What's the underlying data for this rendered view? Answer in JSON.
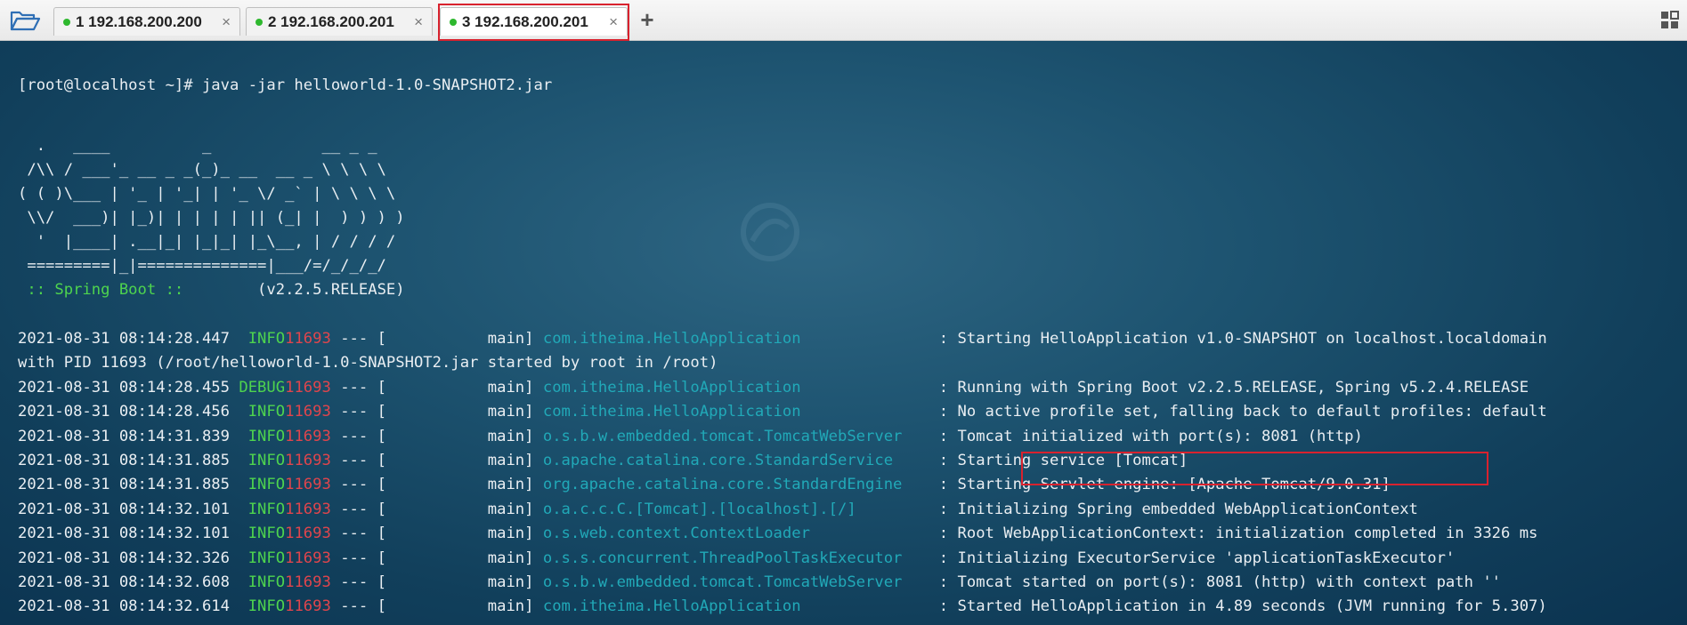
{
  "tabs": [
    {
      "label": "1 192.168.200.200",
      "active": false
    },
    {
      "label": "2 192.168.200.201",
      "active": false
    },
    {
      "label": "3 192.168.200.201",
      "active": true
    }
  ],
  "tab_close_glyph": "×",
  "add_tab_glyph": "+",
  "icons": {
    "open_folder": "folder-open-icon",
    "layout": "grid-layout-icon",
    "status_dot": "green-dot-icon"
  },
  "colors": {
    "highlight_box": "#d9222e",
    "spring_label": "#4ed44e",
    "logger": "#21a9b8",
    "pid": "#e0454c",
    "text": "#e9eef2"
  },
  "terminal": {
    "prompt_line": "[root@localhost ~]# java -jar helloworld-1.0-SNAPSHOT2.jar",
    "banner": [
      "  .   ____          _            __ _ _",
      " /\\\\ / ___'_ __ _ _(_)_ __  __ _ \\ \\ \\ \\",
      "( ( )\\___ | '_ | '_| | '_ \\/ _` | \\ \\ \\ \\",
      " \\\\/  ___)| |_)| | | | | || (_| |  ) ) ) )",
      "  '  |____| .__|_| |_|_| |_\\__, | / / / /",
      " =========|_|==============|___/=/_/_/_/"
    ],
    "spring_label": " :: Spring Boot :: ",
    "spring_version": "       (v2.2.5.RELEASE)",
    "logs": [
      {
        "ts": "2021-08-31 08:14:28.447",
        "level": "  INFO",
        "pid": "11693",
        "thread": " --- [           main] ",
        "logger": "com.itheima.HelloApplication              ",
        "msg": " : Starting HelloApplication v1.0-SNAPSHOT on localhost.localdomain"
      },
      {
        "ts": "",
        "level": "",
        "pid": "",
        "thread": "",
        "logger": "",
        "msg": "with PID 11693 (/root/helloworld-1.0-SNAPSHOT2.jar started by root in /root)"
      },
      {
        "ts": "2021-08-31 08:14:28.455",
        "level": " DEBUG",
        "pid": "11693",
        "thread": " --- [           main] ",
        "logger": "com.itheima.HelloApplication              ",
        "msg": " : Running with Spring Boot v2.2.5.RELEASE, Spring v5.2.4.RELEASE"
      },
      {
        "ts": "2021-08-31 08:14:28.456",
        "level": "  INFO",
        "pid": "11693",
        "thread": " --- [           main] ",
        "logger": "com.itheima.HelloApplication              ",
        "msg": " : No active profile set, falling back to default profiles: default"
      },
      {
        "ts": "2021-08-31 08:14:31.839",
        "level": "  INFO",
        "pid": "11693",
        "thread": " --- [           main] ",
        "logger": "o.s.b.w.embedded.tomcat.TomcatWebServer   ",
        "msg": " : Tomcat initialized with port(s): 8081 (http)"
      },
      {
        "ts": "2021-08-31 08:14:31.885",
        "level": "  INFO",
        "pid": "11693",
        "thread": " --- [           main] ",
        "logger": "o.apache.catalina.core.StandardService    ",
        "msg": " : Starting service [Tomcat]"
      },
      {
        "ts": "2021-08-31 08:14:31.885",
        "level": "  INFO",
        "pid": "11693",
        "thread": " --- [           main] ",
        "logger": "org.apache.catalina.core.StandardEngine   ",
        "msg": " : Starting Servlet engine: [Apache Tomcat/9.0.31]"
      },
      {
        "ts": "2021-08-31 08:14:32.101",
        "level": "  INFO",
        "pid": "11693",
        "thread": " --- [           main] ",
        "logger": "o.a.c.c.C.[Tomcat].[localhost].[/]        ",
        "msg": " : Initializing Spring embedded WebApplicationContext"
      },
      {
        "ts": "2021-08-31 08:14:32.101",
        "level": "  INFO",
        "pid": "11693",
        "thread": " --- [           main] ",
        "logger": "o.s.web.context.ContextLoader             ",
        "msg": " : Root WebApplicationContext: initialization completed in 3326 ms"
      },
      {
        "ts": "2021-08-31 08:14:32.326",
        "level": "  INFO",
        "pid": "11693",
        "thread": " --- [           main] ",
        "logger": "o.s.s.concurrent.ThreadPoolTaskExecutor   ",
        "msg": " : Initializing ExecutorService 'applicationTaskExecutor'"
      },
      {
        "ts": "2021-08-31 08:14:32.608",
        "level": "  INFO",
        "pid": "11693",
        "thread": " --- [           main] ",
        "logger": "o.s.b.w.embedded.tomcat.TomcatWebServer   ",
        "msg": " : Tomcat started on port(s): 8081 (http) with context path ''"
      },
      {
        "ts": "2021-08-31 08:14:32.614",
        "level": "  INFO",
        "pid": "11693",
        "thread": " --- [           main] ",
        "logger": "com.itheima.HelloApplication              ",
        "msg": " : Started HelloApplication in 4.89 seconds (JVM running for 5.307)"
      }
    ]
  }
}
